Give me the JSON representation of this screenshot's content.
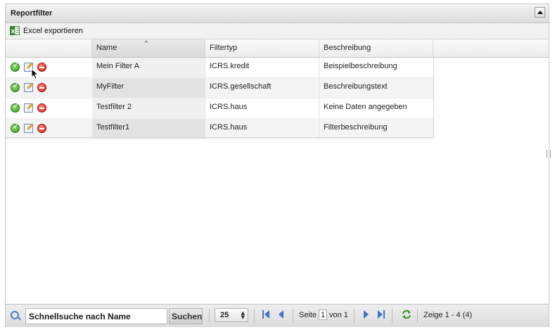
{
  "panel": {
    "title": "Reportfilter",
    "collapse_icon": "chevron-up-icon"
  },
  "toolbar": {
    "export_label": "Excel exportieren",
    "export_icon": "excel-icon"
  },
  "grid": {
    "columns": [
      {
        "label": ""
      },
      {
        "label": "Name",
        "sorted": true
      },
      {
        "label": "Filtertyp"
      },
      {
        "label": "Beschreibung"
      }
    ],
    "rows": [
      {
        "name": "Mein Filter A",
        "type": "ICRS.kredit",
        "description": "Beispielbeschreibung"
      },
      {
        "name": "MyFilter",
        "type": "ICRS.gesellschaft",
        "description": "Beschreibungstext"
      },
      {
        "name": "Testfilter 2",
        "type": "ICRS.haus",
        "description": "Keine Daten angegeben"
      },
      {
        "name": "Testfilter1",
        "type": "ICRS.haus",
        "description": "Filterbeschreibung"
      }
    ],
    "row_actions": [
      "activate-icon",
      "edit-icon",
      "delete-icon"
    ]
  },
  "footer": {
    "search_placeholder": "Schnellsuche nach Name",
    "search_button": "Suchen",
    "page_size": "25",
    "page_label": "Seite",
    "page_current": "1",
    "page_of": "von 1",
    "summary": "Zeige 1 - 4 (4)"
  },
  "colors": {
    "accent": "#3f73c7",
    "ok": "#2f9a1a",
    "delete": "#cc1b10"
  }
}
